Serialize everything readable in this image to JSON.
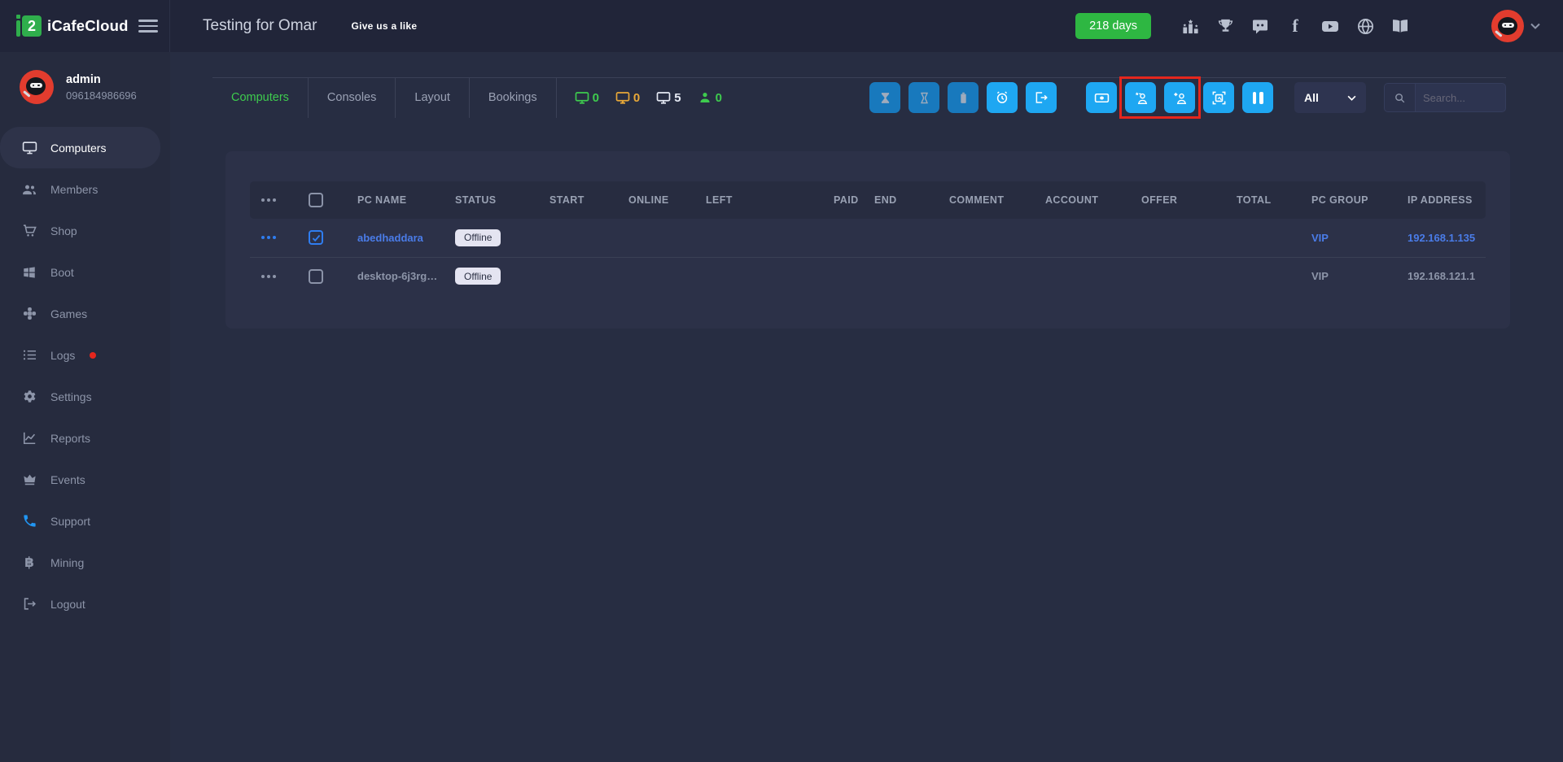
{
  "brand": {
    "name": "iCafeCloud"
  },
  "topbar": {
    "cafe_name": "Testing for Omar",
    "like_label": "Give us a like",
    "days_badge": "218 days",
    "icons": [
      "podium-icon",
      "trophy-icon",
      "discord-icon",
      "facebook-icon",
      "youtube-icon",
      "globe-icon",
      "book-icon"
    ]
  },
  "user": {
    "name": "admin",
    "phone": "096184986696"
  },
  "sidebar": {
    "items": [
      {
        "label": "Computers",
        "icon": "monitor-icon",
        "active": true
      },
      {
        "label": "Members",
        "icon": "people-icon"
      },
      {
        "label": "Shop",
        "icon": "cart-icon"
      },
      {
        "label": "Boot",
        "icon": "windows-icon"
      },
      {
        "label": "Games",
        "icon": "gamepad-icon"
      },
      {
        "label": "Logs",
        "icon": "list-icon",
        "notification": "red-dot"
      },
      {
        "label": "Settings",
        "icon": "gear-icon"
      },
      {
        "label": "Reports",
        "icon": "chart-icon"
      },
      {
        "label": "Events",
        "icon": "crown-icon"
      },
      {
        "label": "Support",
        "icon": "phone-icon"
      },
      {
        "label": "Mining",
        "icon": "bitcoin-icon"
      },
      {
        "label": "Logout",
        "icon": "logout-icon"
      }
    ]
  },
  "tabs": [
    {
      "label": "Computers",
      "active": true
    },
    {
      "label": "Consoles"
    },
    {
      "label": "Layout"
    },
    {
      "label": "Bookings"
    }
  ],
  "status_counts": [
    {
      "icon": "monitor-icon",
      "color": "#3ecb4e",
      "value": "0"
    },
    {
      "icon": "monitor-icon",
      "color": "#e8a838",
      "value": "0"
    },
    {
      "icon": "monitor-icon",
      "color": "#e6eaf4",
      "value": "5"
    },
    {
      "icon": "person-icon",
      "color": "#3ecb4e",
      "value": "0"
    }
  ],
  "toolbar": {
    "buttons_group1": [
      {
        "icon": "hourglass-filled-icon",
        "enabled": false
      },
      {
        "icon": "hourglass-icon",
        "enabled": false
      },
      {
        "icon": "battery-icon",
        "enabled": false
      },
      {
        "icon": "alarm-clock-icon",
        "enabled": true
      },
      {
        "icon": "sign-out-icon",
        "enabled": true
      }
    ],
    "buttons_group2": [
      {
        "icon": "cash-icon"
      },
      {
        "icon": "add-member-star-icon",
        "highlighted": true
      },
      {
        "icon": "add-member-icon",
        "highlighted": true
      },
      {
        "icon": "image-frame-icon"
      },
      {
        "icon": "pause-icon"
      }
    ],
    "filter": {
      "selected": "All"
    },
    "search": {
      "placeholder": "Search..."
    }
  },
  "table": {
    "columns": [
      "PC NAME",
      "STATUS",
      "START",
      "ONLINE",
      "LEFT",
      "PAID",
      "END",
      "COMMENT",
      "ACCOUNT",
      "OFFER",
      "TOTAL",
      "PC GROUP",
      "IP ADDRESS"
    ],
    "rows": [
      {
        "pc_name": "abedhaddara",
        "status": "Offline",
        "pc_group": "VIP",
        "ip_address": "192.168.1.135",
        "selected": true
      },
      {
        "pc_name": "desktop-6j3rg…",
        "status": "Offline",
        "pc_group": "VIP",
        "ip_address": "192.168.121.1",
        "selected": false
      }
    ]
  },
  "colors": {
    "accent_green": "#2eb742",
    "accent_blue": "#1ea7f2",
    "annotation_red": "#e5261d",
    "link_blue": "#4a7ce8"
  }
}
